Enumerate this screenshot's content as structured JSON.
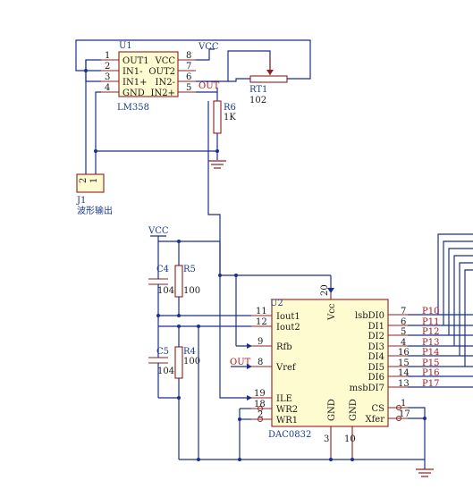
{
  "u1": {
    "designator": "U1",
    "part": "LM358",
    "pins_left": [
      {
        "num": "1",
        "name": "OUT1"
      },
      {
        "num": "2",
        "name": "IN1-"
      },
      {
        "num": "3",
        "name": "IN1+"
      },
      {
        "num": "4",
        "name": "GND"
      }
    ],
    "pins_right": [
      {
        "num": "8",
        "name": "VCC"
      },
      {
        "num": "7",
        "name": "OUT2"
      },
      {
        "num": "6",
        "name": "IN2-"
      },
      {
        "num": "5",
        "name": "IN2+"
      }
    ]
  },
  "rt1": {
    "designator": "RT1",
    "value": "102"
  },
  "r6": {
    "designator": "R6",
    "value": "1K"
  },
  "r5": {
    "designator": "R5",
    "value": "100"
  },
  "r4": {
    "designator": "R4",
    "value": "100"
  },
  "c4": {
    "designator": "C4",
    "value": "104"
  },
  "c5": {
    "designator": "C5",
    "value": "104"
  },
  "j1": {
    "designator": "J1",
    "label": "波形输出",
    "pins": [
      "2",
      "1"
    ]
  },
  "nets": {
    "vcc_top": "VCC",
    "out_top": "OUT",
    "vcc_left": "VCC",
    "out_left": "OUT"
  },
  "u2": {
    "designator": "U2",
    "part": "DAC0832",
    "vcc_pin": {
      "num": "20",
      "name": "Vcc"
    },
    "pins_left": [
      {
        "num": "11",
        "name": "Iout1"
      },
      {
        "num": "12",
        "name": "Iout2"
      },
      {
        "num": "9",
        "name": "Rfb"
      },
      {
        "num": "8",
        "name": "Vref"
      },
      {
        "num": "19",
        "name": "ILE"
      },
      {
        "num": "18",
        "name": "WR2"
      },
      {
        "num": "2",
        "name": "WR1"
      }
    ],
    "pins_right": [
      {
        "num": "7",
        "name": "lsbDI0",
        "net": "P10"
      },
      {
        "num": "6",
        "name": "DI1",
        "net": "P11"
      },
      {
        "num": "5",
        "name": "DI2",
        "net": "P12"
      },
      {
        "num": "4",
        "name": "DI3",
        "net": "P13"
      },
      {
        "num": "16",
        "name": "DI4",
        "net": "P14"
      },
      {
        "num": "15",
        "name": "DI5",
        "net": "P15"
      },
      {
        "num": "14",
        "name": "DI6",
        "net": "P16"
      },
      {
        "num": "13",
        "name": "msbDI7",
        "net": "P17"
      }
    ],
    "ctrl_right": [
      {
        "num": "1",
        "name": "CS"
      },
      {
        "num": "17",
        "name": "Xfer"
      }
    ],
    "gnd_pins": [
      {
        "num": "3",
        "name": "GND"
      },
      {
        "num": "10",
        "name": "GND"
      }
    ]
  }
}
